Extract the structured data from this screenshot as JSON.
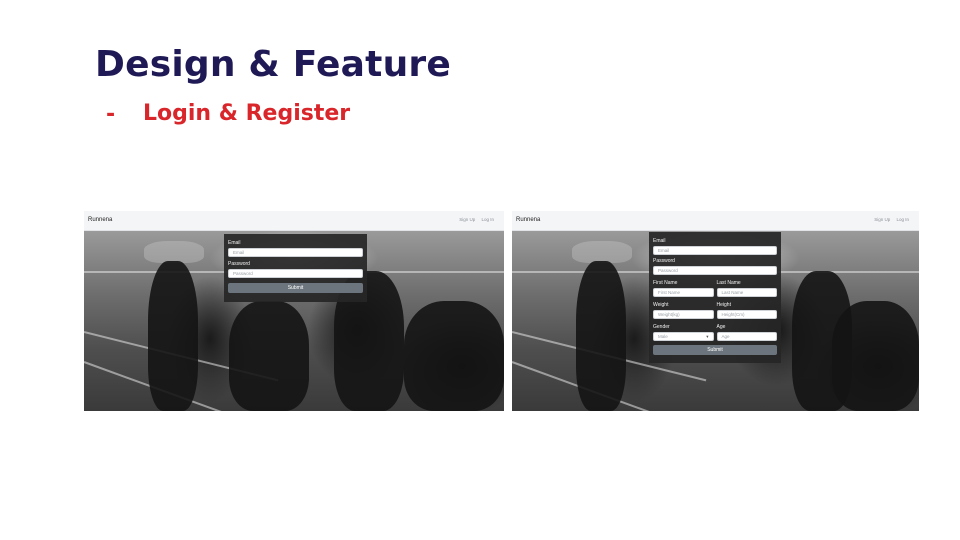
{
  "slide": {
    "title": "Design & Feature",
    "bullet_dash": "-",
    "bullet_text": "Login & Register"
  },
  "login_shot": {
    "brand": "Runnena",
    "nav_signup": "Sign Up",
    "nav_login": "Log In",
    "form": {
      "email_label": "Email",
      "email_placeholder": "Email",
      "password_label": "Password",
      "password_placeholder": "Password",
      "submit_label": "Submit"
    }
  },
  "register_shot": {
    "brand": "Runnena",
    "nav_signup": "Sign Up",
    "nav_login": "Log In",
    "form": {
      "email_label": "Email",
      "email_placeholder": "Email",
      "password_label": "Password",
      "password_placeholder": "Password",
      "first_name_label": "First Name",
      "first_name_placeholder": "First Name",
      "last_name_label": "Last Name",
      "last_name_placeholder": "Last Name",
      "weight_label": "Weight",
      "weight_placeholder": "Weight(kg)",
      "height_label": "Height",
      "height_placeholder": "Height(Cm)",
      "gender_label": "Gender",
      "gender_value": "Male",
      "age_label": "Age",
      "age_placeholder": "Age",
      "submit_label": "Submit"
    }
  },
  "colors": {
    "title": "#1f1a55",
    "accent": "#d9262b",
    "form_bg": "#262626",
    "submit_btn": "#6c757d"
  }
}
